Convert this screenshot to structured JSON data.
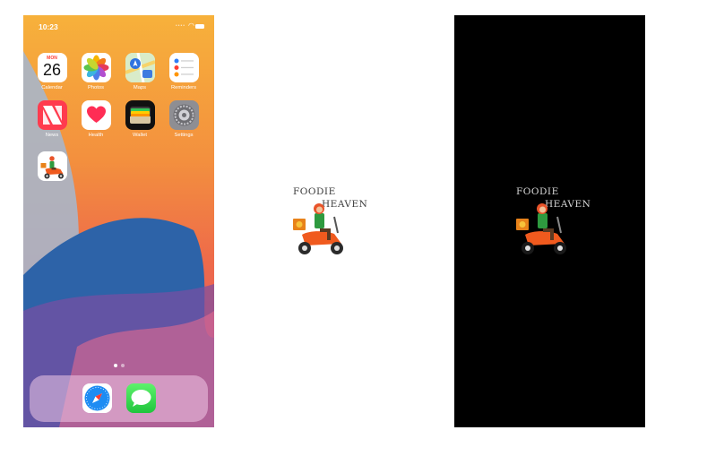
{
  "home": {
    "status_time": "10:23",
    "apps": [
      {
        "label": "Calendar",
        "icon": "calendar-icon"
      },
      {
        "label": "Photos",
        "icon": "photos-icon"
      },
      {
        "label": "Maps",
        "icon": "maps-icon"
      },
      {
        "label": "Reminders",
        "icon": "reminders-icon"
      },
      {
        "label": "News",
        "icon": "news-icon"
      },
      {
        "label": "Health",
        "icon": "health-icon"
      },
      {
        "label": "Wallet",
        "icon": "wallet-icon"
      },
      {
        "label": "Settings",
        "icon": "settings-icon"
      },
      {
        "label": "",
        "icon": "foodie-heaven-app-icon"
      }
    ],
    "calendar": {
      "month": "MON",
      "day": "26"
    },
    "dock": [
      {
        "label": "",
        "icon": "safari-icon"
      },
      {
        "label": "",
        "icon": "messages-icon"
      }
    ],
    "page_count": 2,
    "current_page": 1
  },
  "splash": {
    "line1": "FOODIE",
    "line2": "HEAVEN"
  },
  "colors": {
    "scooter": "#f05a1e",
    "rider_shirt": "#2e9a3f",
    "helmet": "#e9542a",
    "light_bg": "#ffffff",
    "dark_bg": "#000000"
  }
}
